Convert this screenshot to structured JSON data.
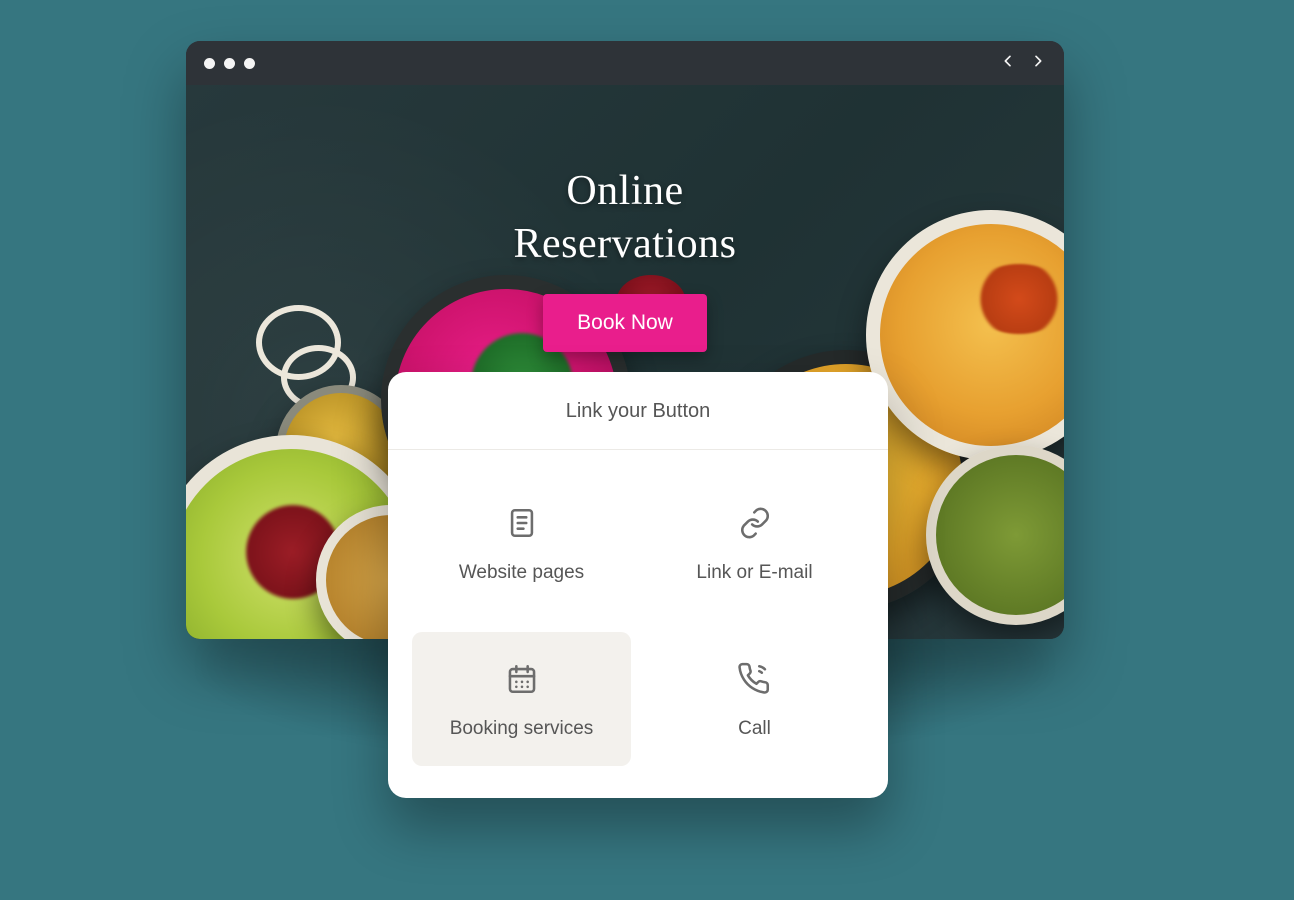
{
  "hero": {
    "title_line1": "Online",
    "title_line2": "Reservations",
    "cta_label": "Book Now"
  },
  "popover": {
    "title": "Link your Button",
    "options": [
      {
        "label": "Website pages",
        "icon": "pages-icon",
        "selected": false
      },
      {
        "label": "Link or E-mail",
        "icon": "link-icon",
        "selected": false
      },
      {
        "label": "Booking services",
        "icon": "calendar-icon",
        "selected": true
      },
      {
        "label": "Call",
        "icon": "phone-icon",
        "selected": false
      }
    ]
  },
  "colors": {
    "accent": "#e91e8c",
    "page_bg": "#367680"
  }
}
